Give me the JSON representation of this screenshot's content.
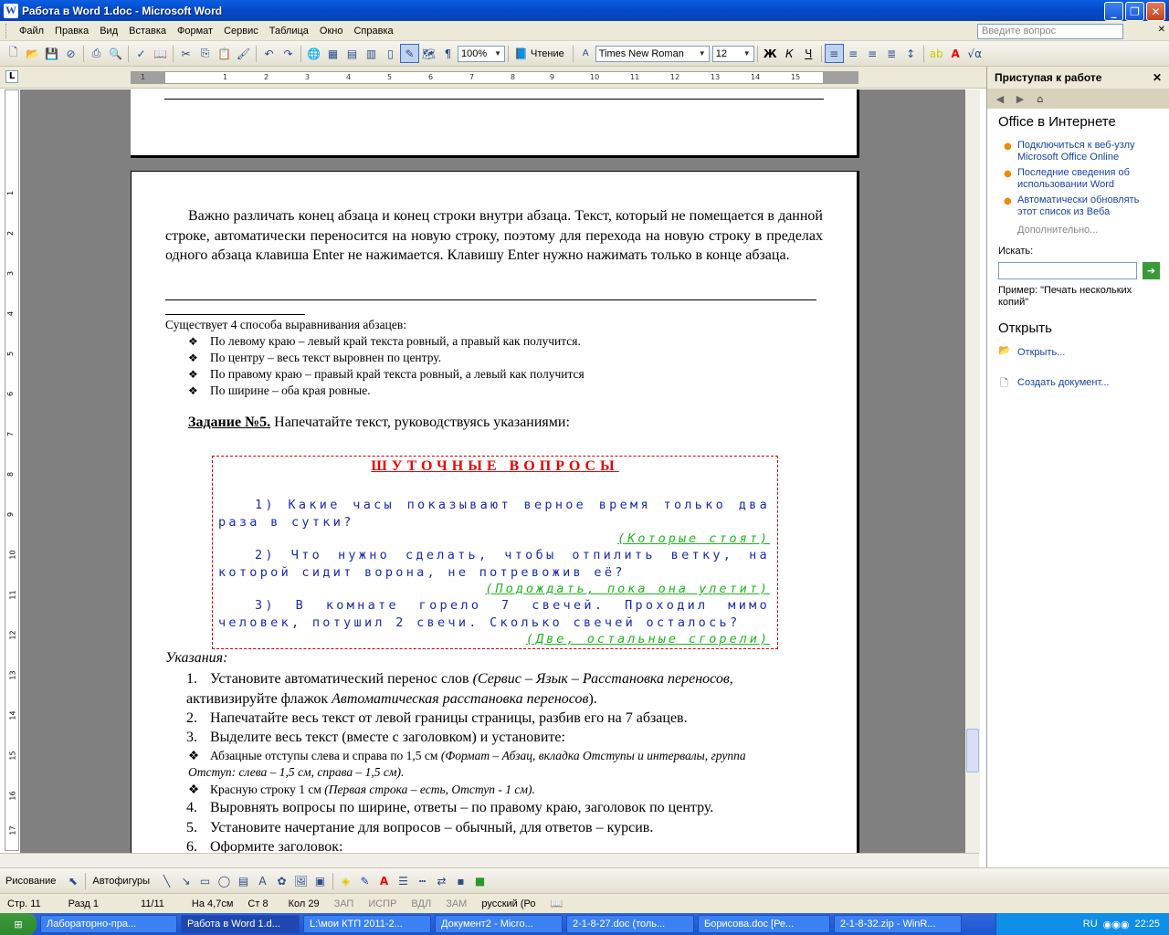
{
  "window": {
    "title": "Работа в Word 1.doc - Microsoft Word"
  },
  "menu": [
    "Файл",
    "Правка",
    "Вид",
    "Вставка",
    "Формат",
    "Сервис",
    "Таблица",
    "Окно",
    "Справка"
  ],
  "ask": {
    "placeholder": "Введите вопрос"
  },
  "toolbar": {
    "zoom": "100%",
    "read": "Чтение",
    "font": "Times New Roman",
    "size": "12"
  },
  "ruler": {
    "ticks": [
      "1",
      "2",
      "1",
      "2",
      "3",
      "4",
      "5",
      "6",
      "7",
      "8",
      "9",
      "10",
      "11",
      "12",
      "13",
      "14",
      "15",
      "16",
      "17"
    ]
  },
  "vruler": {
    "ticks": [
      "1",
      "2",
      "3",
      "4",
      "5",
      "6",
      "7",
      "8",
      "9",
      "10",
      "11",
      "12",
      "13",
      "14",
      "15",
      "16",
      "17",
      "18"
    ]
  },
  "doc": {
    "para1": "Важно различать конец абзаца и конец строки внутри абзаца. Текст, который не помещается в данной строке, автоматически переносится на новую строку, поэтому для перехода на новую строку в пределах одного абзаца клавиша Enter не нажимается. Клавишу Enter нужно нажимать только в конце абзаца.",
    "intro": "Существует 4 способа выравнивания абзацев:",
    "bullets": [
      "По левому краю – левый край текста ровный, а правый как получится.",
      "По центру – весь текст выровнен по центру.",
      "По правому краю – правый край текста ровный, а левый как получится",
      "По ширине – оба края ровные."
    ],
    "task_bold": "Задание №5.",
    "task_text": " Напечатайте текст, руководствуясь указаниями:",
    "joke_title": "ШУТОЧНЫЕ ВОПРОСЫ",
    "q1": "1) Какие часы показывают верное время только два раза в сутки?",
    "a1": "(Которые стоят)",
    "q2": "2) Что нужно сделать, чтобы отпилить ветку, на которой сидит ворона, не потревожив её?",
    "a2": "(Подождать, пока она улетит)",
    "q3": "3) В комнате горело 7 свечей. Проходил мимо человек, потушил 2 свечи. Сколько свечей осталось?",
    "a3": "(Две, остальные сгорели)",
    "ukaz": "Указания:",
    "i1_n": "1.",
    "i1a": "Установите автоматический перенос слов ",
    "i1b": "(Сервис – Язык – Расстановка переносов",
    ", активизируйте флажок ": "",
    "i1c": ", активизируйте флажок ",
    "i1d": "Автоматическая расстановка переносов",
    "i1e": ").",
    "i2_n": "2.",
    "i2": "Напечатайте весь текст от левой границы страницы, разбив его на 7 абзацев.",
    "i3_n": "3.",
    "i3": "Выделите весь текст (вместе с заголовком) и установите:",
    "s1a": "Абзацные отступы слева и справа по 1,5 см ",
    "s1b": "(Формат – Абзац, вкладка Отступы и интервалы, группа Отступ: слева – 1,5 см, справа – 1,5 см).",
    "s2a": "Красную строку 1 см ",
    "s2b": "(Первая строка – есть, Отступ - 1 см).",
    "i4_n": "4.",
    "i4": "Выровнять вопросы по ширине, ответы – по правому краю, заголовок по центру.",
    "i5_n": "5.",
    "i5": "Установите начертание для вопросов – обычный, для ответов – курсив.",
    "i6_n": "6.",
    "i6": "Оформите заголовок:"
  },
  "taskpane": {
    "title": "Приступая к работе",
    "section1": "Office в Интернете",
    "links": [
      "Подключиться к веб-узлу Microsoft Office Online",
      "Последние сведения об использовании Word",
      "Автоматически обновлять этот список из Веба"
    ],
    "more": "Дополнительно...",
    "search_label": "Искать:",
    "example": "Пример:  \"Печать нескольких копий\"",
    "section2": "Открыть",
    "open": "Открыть...",
    "create": "Создать документ..."
  },
  "drawing": {
    "draw": "Рисование",
    "autoshapes": "Автофигуры"
  },
  "status": {
    "page": "Стр. 11",
    "section": "Разд 1",
    "pages": "11/11",
    "at": "На 4,7см",
    "line": "Ст 8",
    "col": "Кол 29",
    "rec": "ЗАП",
    "trk": "ИСПР",
    "ext": "ВДЛ",
    "ovr": "ЗАМ",
    "lang": "русский (Ро"
  },
  "taskbar": {
    "items": [
      "Лабораторно-пра...",
      "Работа в Word 1.d...",
      "L:\\мои КТП 2011-2...",
      "Документ2 - Micro...",
      "2-1-8-27.doc (толь...",
      "Борисова.doc [Ре...",
      "2-1-8-32.zip - WinR..."
    ],
    "lang": "RU",
    "time": "22:25"
  }
}
